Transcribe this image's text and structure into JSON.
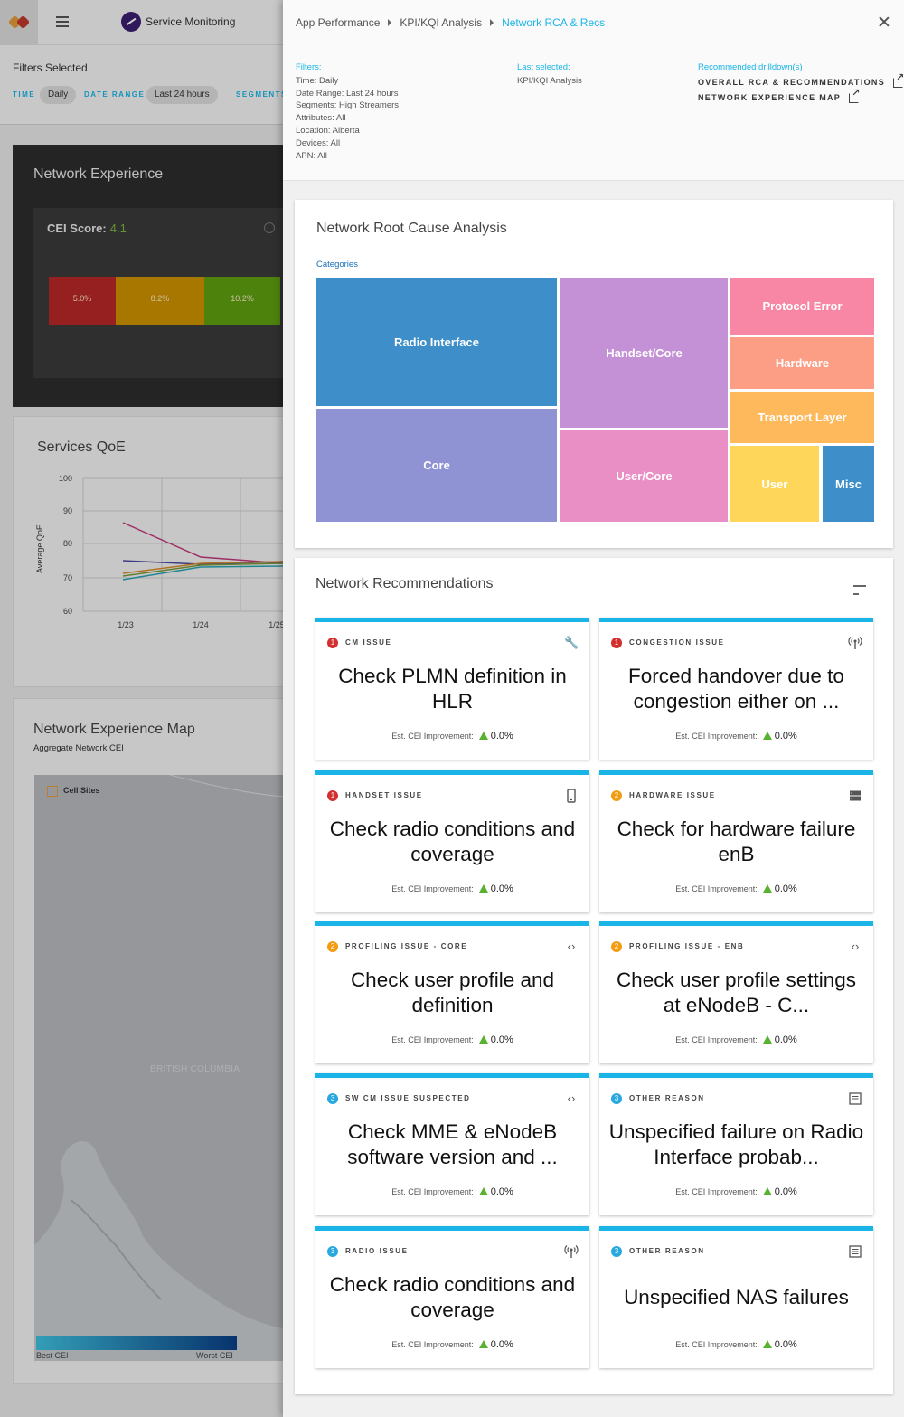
{
  "background": {
    "app_title": "Service Monitoring",
    "filters_title": "Filters Selected",
    "chips": [
      {
        "label": "TIME",
        "value": "Daily"
      },
      {
        "label": "DATE RANGE",
        "value": "Last 24 hours"
      },
      {
        "label": "SEGMENTS",
        "value": ""
      }
    ],
    "network_experience": {
      "title": "Network Experience",
      "cei_label": "CEI Score:",
      "cei_value": "4.1",
      "bars": [
        {
          "label": "5.0%",
          "color": "#b82828"
        },
        {
          "label": "8.2%",
          "color": "#cc9200"
        },
        {
          "label": "10.2%",
          "color": "#5fa010"
        }
      ]
    },
    "services_qoe": {
      "title": "Services QoE",
      "ylabel": "Average QoE",
      "yticks": [
        "100",
        "90",
        "80",
        "70",
        "60"
      ],
      "xticks": [
        "1/23",
        "1/24",
        "1/25"
      ]
    },
    "map": {
      "title": "Network Experience Map",
      "subtitle": "Aggregate Network CEI",
      "legend_label": "Cell Sites",
      "region_label": "BRITISH COLUMBIA",
      "best_label": "Best CEI",
      "worst_label": "Worst CEI"
    }
  },
  "drawer": {
    "breadcrumb": [
      "App Performance",
      "KPI/KQI Analysis",
      "Network RCA & Recs"
    ],
    "filters": {
      "title": "Filters:",
      "lines": [
        "Time: Daily",
        "Date Range: Last 24 hours",
        "Segments: High Streamers",
        "Attributes: All",
        "Location: Alberta",
        "Devices: All",
        "APN: All"
      ]
    },
    "last_selected": {
      "title": "Last selected:",
      "value": "KPI/KQI Analysis"
    },
    "drilldowns": {
      "title": "Recommended drilldown(s)",
      "links": [
        "OVERALL RCA & RECOMMENDATIONS",
        "NETWORK EXPERIENCE MAP"
      ]
    },
    "rca": {
      "title": "Network Root Cause Analysis",
      "categories_label": "Categories",
      "tiles": [
        {
          "label": "Radio Interface",
          "color": "#3d8ec9"
        },
        {
          "label": "Core",
          "color": "#8f93d3"
        },
        {
          "label": "Handset/Core",
          "color": "#c491d6"
        },
        {
          "label": "User/Core",
          "color": "#ea8ec6"
        },
        {
          "label": "Protocol Error",
          "color": "#f887a5"
        },
        {
          "label": "Hardware",
          "color": "#fb9e85"
        },
        {
          "label": "Transport Layer",
          "color": "#fdb95b"
        },
        {
          "label": "User",
          "color": "#fed65a"
        },
        {
          "label": "Misc",
          "color": "#3d8ec9"
        }
      ]
    },
    "recs": {
      "title": "Network Recommendations",
      "est_label": "Est. CEI Improvement:",
      "items": [
        {
          "priority": "1",
          "type": "CM ISSUE",
          "icon": "wrench-icon",
          "text": "Check PLMN definition in HLR",
          "value": "0.0%"
        },
        {
          "priority": "1",
          "type": "CONGESTION ISSUE",
          "icon": "antenna-icon",
          "text": "Forced handover due to congestion either on ...",
          "value": "0.0%"
        },
        {
          "priority": "1",
          "type": "HANDSET ISSUE",
          "icon": "phone-icon",
          "text": "Check radio conditions and coverage",
          "value": "0.0%"
        },
        {
          "priority": "2",
          "type": "HARDWARE ISSUE",
          "icon": "server-icon",
          "text": "Check for hardware failure enB",
          "value": "0.0%"
        },
        {
          "priority": "2",
          "type": "PROFILING ISSUE - CORE",
          "icon": "code-icon",
          "text": "Check user profile and definition",
          "value": "0.0%"
        },
        {
          "priority": "2",
          "type": "PROFILING ISSUE - ENB",
          "icon": "code-icon",
          "text": "Check user profile settings at eNodeB - C...",
          "value": "0.0%"
        },
        {
          "priority": "3",
          "type": "SW CM ISSUE SUSPECTED",
          "icon": "code-icon",
          "text": "Check MME & eNodeB software version and ...",
          "value": "0.0%"
        },
        {
          "priority": "3",
          "type": "OTHER REASON",
          "icon": "list-icon",
          "text": "Unspecified failure on Radio Interface probab...",
          "value": "0.0%"
        },
        {
          "priority": "3",
          "type": "RADIO ISSUE",
          "icon": "antenna-icon",
          "text": "Check radio conditions and coverage",
          "value": "0.0%"
        },
        {
          "priority": "3",
          "type": "OTHER REASON",
          "icon": "list-icon",
          "text": "Unspecified NAS failures",
          "value": "0.0%"
        }
      ]
    }
  }
}
